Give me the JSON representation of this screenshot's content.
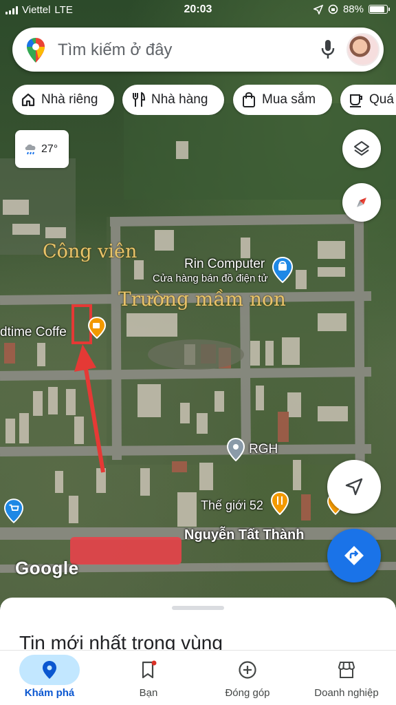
{
  "status_bar": {
    "carrier": "Viettel",
    "network": "LTE",
    "time": "20:03",
    "battery": "88%",
    "battery_level": 0.88
  },
  "search": {
    "placeholder": "Tìm kiếm ở đây"
  },
  "chips": [
    {
      "label": "Nhà riêng",
      "icon": "home-icon"
    },
    {
      "label": "Nhà hàng",
      "icon": "restaurant-icon"
    },
    {
      "label": "Mua sắm",
      "icon": "shopping-bag-icon"
    },
    {
      "label": "Quá",
      "icon": "coffee-icon"
    }
  ],
  "weather": {
    "temp": "27°",
    "icon": "rain-cloud-icon"
  },
  "map": {
    "labels": {
      "park": "Công viên",
      "school": "Trường mầm non",
      "rin_title": "Rin Computer",
      "rin_subtitle": "Cửa hàng bán đồ điện tử",
      "coffee": "dtime Coffe",
      "rgh": "RGH",
      "the_gioi": "Thế giới 52",
      "street": "Nguyễn Tất Thành",
      "google": "Google"
    },
    "colors": {
      "road": "#8c8c84",
      "annotation_red": "#e53935",
      "poi_blue": "#1e88e5",
      "poi_orange": "#f29900"
    }
  },
  "sheet": {
    "title": "Tin mới nhất trong vùng"
  },
  "bottom_nav": {
    "items": [
      {
        "label": "Khám phá",
        "icon": "explore-pin-icon",
        "active": true
      },
      {
        "label": "Bạn",
        "icon": "bookmark-icon",
        "active": false
      },
      {
        "label": "Đóng góp",
        "icon": "add-circle-icon",
        "active": false
      },
      {
        "label": "Doanh nghiệp",
        "icon": "storefront-icon",
        "active": false
      }
    ]
  }
}
